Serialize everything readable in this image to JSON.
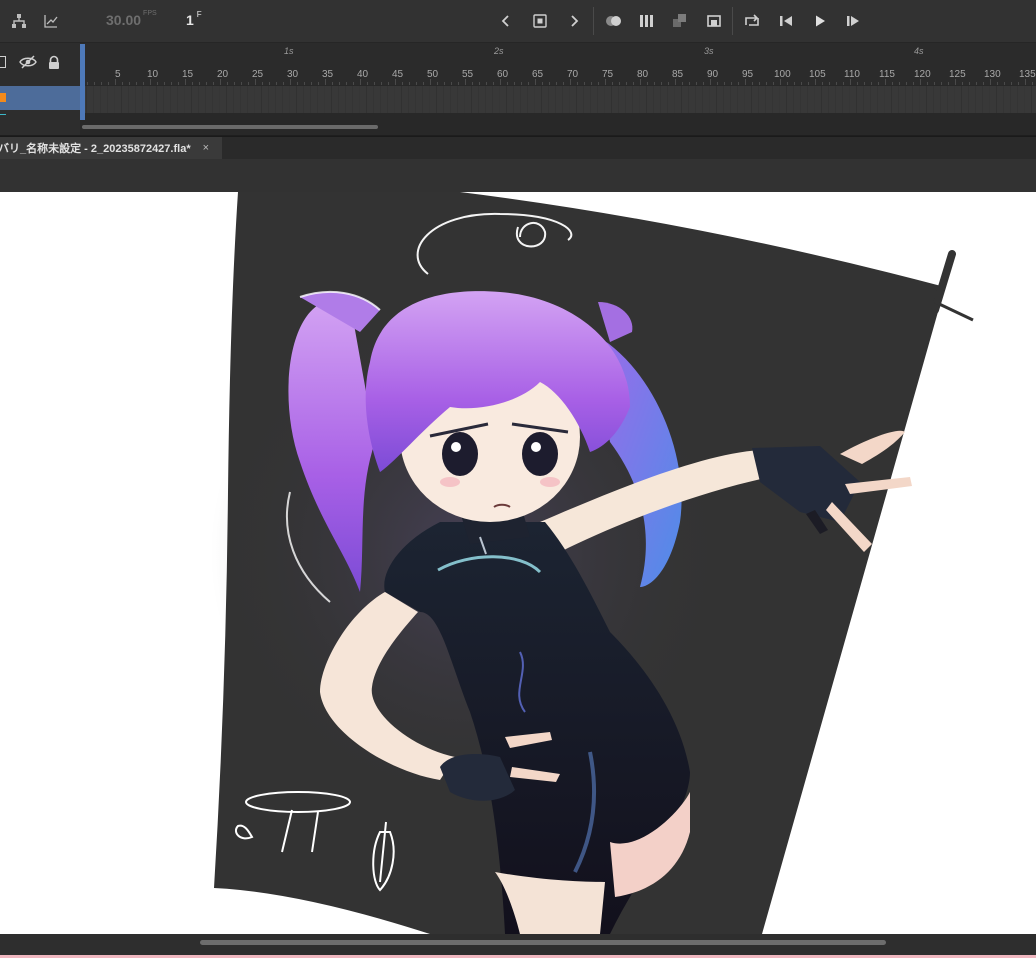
{
  "toolbar": {
    "fps_value": "30.00",
    "fps_unit": "FPS",
    "frame_value": "1",
    "frame_unit": "F",
    "icons": [
      "hierarchy-icon",
      "graph-icon",
      "prev-keyframe-icon",
      "insert-keyframe-icon",
      "next-keyframe-icon",
      "onion-skin-icon",
      "edit-multiple-frames-icon",
      "center-frame-icon",
      "loop-icon",
      "loop-playback-icon",
      "step-back-icon",
      "play-icon",
      "step-forward-icon"
    ]
  },
  "timeline": {
    "seconds": [
      "1s",
      "2s",
      "3s",
      "4s"
    ],
    "frame_numbers": [
      "5",
      "10",
      "15",
      "20",
      "25",
      "30",
      "35",
      "40",
      "45",
      "50",
      "55",
      "60",
      "65",
      "70",
      "75",
      "80",
      "85",
      "90",
      "95",
      "100",
      "105",
      "110",
      "115",
      "120",
      "125",
      "130",
      "135"
    ],
    "layer_colors": {
      "accent": "#f38a1c",
      "selected_row": "#4d6c9a",
      "playhead": "#4f7fc8"
    }
  },
  "document": {
    "tab_title": "バリ_名称未設定 - 2_20235872427.fla*",
    "close_glyph": "×"
  },
  "colors": {
    "toolbar_bg": "#323232",
    "stage_bg": "#ffffff",
    "flag_bg": "#333333",
    "hair": "#b67be8",
    "outfit": "#1b1d2a"
  }
}
